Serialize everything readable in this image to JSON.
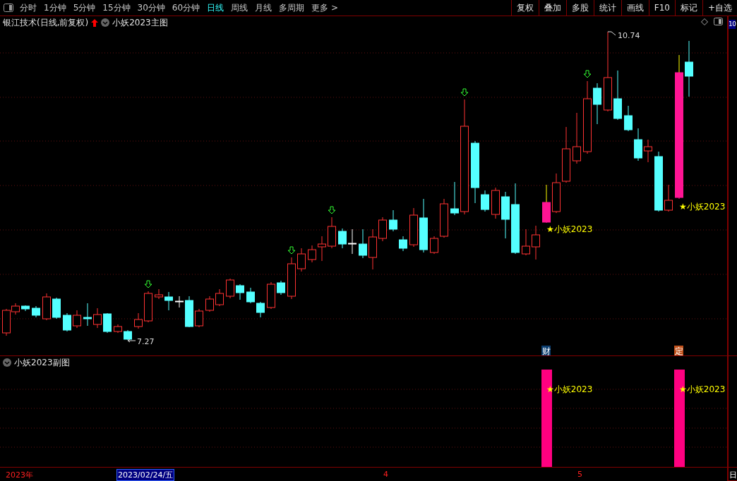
{
  "toolbar": {
    "periods": [
      {
        "label": "分时",
        "selected": false
      },
      {
        "label": "1分钟",
        "selected": false
      },
      {
        "label": "5分钟",
        "selected": false
      },
      {
        "label": "15分钟",
        "selected": false
      },
      {
        "label": "30分钟",
        "selected": false
      },
      {
        "label": "60分钟",
        "selected": false
      },
      {
        "label": "日线",
        "selected": true
      },
      {
        "label": "周线",
        "selected": false
      },
      {
        "label": "月线",
        "selected": false
      },
      {
        "label": "多周期",
        "selected": false
      },
      {
        "label": "更多 >",
        "selected": false
      }
    ],
    "actions": [
      "复权",
      "叠加",
      "多股",
      "统计",
      "画线",
      "F10",
      "标记",
      "+自选"
    ]
  },
  "main_chart": {
    "title": "银江技术(日线,前复权)",
    "indicator": "小妖2023主图",
    "high_label": "10.74",
    "low_label": "7.27",
    "signal_labels": [
      "★小妖2023",
      "★小妖2023"
    ],
    "event_markers": [
      {
        "label": "财",
        "color": "#0b3d6e"
      },
      {
        "label": "定",
        "color": "#c0501a"
      }
    ],
    "price_axis_label": "10"
  },
  "sub_chart": {
    "indicator": "小妖2023副图",
    "signal_labels": [
      "★小妖2023",
      "★小妖2023"
    ]
  },
  "time_axis": {
    "labels": [
      "2023年",
      "4",
      "5"
    ],
    "cursor_date": "2023/02/24/五",
    "corner": "日"
  }
}
